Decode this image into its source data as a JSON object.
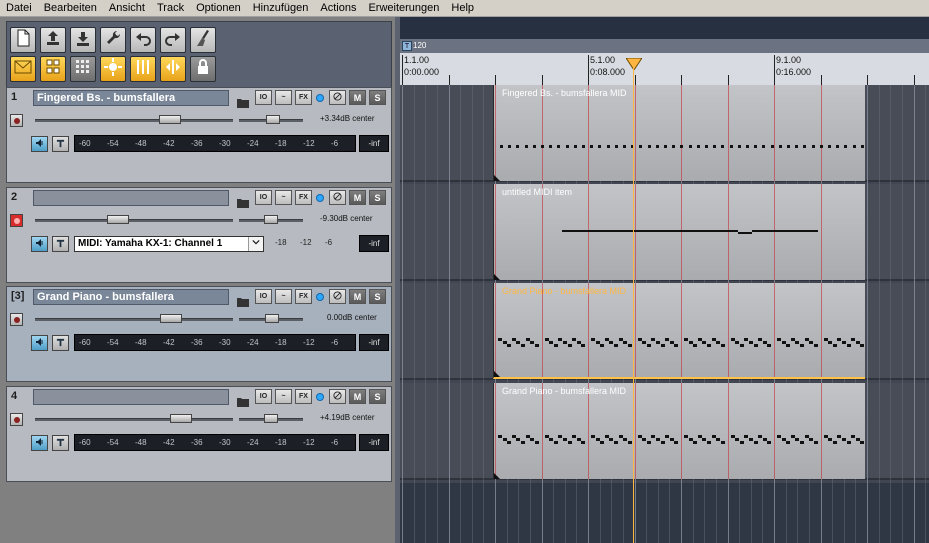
{
  "menu": [
    "Datei",
    "Bearbeiten",
    "Ansicht",
    "Track",
    "Optionen",
    "Hinzufügen",
    "Actions",
    "Erweiterungen",
    "Help"
  ],
  "toolbar": {
    "row1": [
      "new-file-icon",
      "upload-icon",
      "download-icon",
      "wrench-icon",
      "undo-icon",
      "redo-icon",
      "broom-icon"
    ],
    "row2": [
      "envelope-icon",
      "grid-items-icon",
      "grid-dots-icon",
      "burst-icon",
      "bars-icon",
      "split-icon",
      "lock-icon"
    ]
  },
  "tracks": [
    {
      "num": "1",
      "name": "Fingered Bs.  - bumsfallera",
      "volume": "+3.34dB",
      "pan": "center",
      "armed": false,
      "input": "",
      "meter_ticks": [
        "-60",
        "-54",
        "-48",
        "-42",
        "-36",
        "-30",
        "-24",
        "-18",
        "-12",
        "-6"
      ],
      "peak": "-inf",
      "selected": false
    },
    {
      "num": "2",
      "name": "",
      "volume": "-9.30dB",
      "pan": "center",
      "armed": true,
      "input": "MIDI: Yamaha KX-1: Channel 1",
      "meter_ticks": [
        "-18",
        "-12",
        "-6"
      ],
      "peak": "-inf",
      "selected": false
    },
    {
      "num": "[3]",
      "name": "Grand Piano  - bumsfallera",
      "volume": "0.00dB",
      "pan": "center",
      "armed": false,
      "input": "",
      "meter_ticks": [
        "-60",
        "-54",
        "-48",
        "-42",
        "-36",
        "-30",
        "-24",
        "-18",
        "-12",
        "-6"
      ],
      "peak": "-inf",
      "selected": true
    },
    {
      "num": "4",
      "name": "",
      "volume": "+4.19dB",
      "pan": "center",
      "armed": false,
      "input": "",
      "meter_ticks": [
        "-60",
        "-54",
        "-48",
        "-42",
        "-36",
        "-30",
        "-24",
        "-18",
        "-12",
        "-6"
      ],
      "peak": "-inf",
      "selected": false
    }
  ],
  "track_buttons": {
    "io": "IO",
    "env": "~",
    "fx": "FX",
    "mute": "M",
    "solo": "S"
  },
  "ruler": {
    "tempo": "120",
    "markers": [
      {
        "bar": "1.1.00",
        "time": "0:00.000"
      },
      {
        "bar": "5.1.00",
        "time": "0:08.000"
      },
      {
        "bar": "9.1.00",
        "time": "0:16.000"
      }
    ]
  },
  "items": [
    {
      "label": "Fingered Bs.  - bumsfallera MID",
      "selected": false
    },
    {
      "label": "untitled MIDI item",
      "selected": false
    },
    {
      "label": "Grand Piano  - bumsfallera MID",
      "selected": true
    },
    {
      "label": "Grand Piano  - bumsfallera MID",
      "selected": false
    }
  ],
  "colors": {
    "accent": "#ffc24a",
    "cursor": "#ffb640",
    "item_selected_label": "#ffb640",
    "armed": "#d82b2b"
  }
}
